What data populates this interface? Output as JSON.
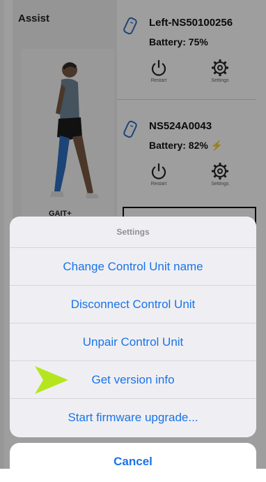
{
  "assist": {
    "title": "Assist",
    "gait_label": "GAIT+"
  },
  "devices": [
    {
      "name": "Left-NS50100256",
      "battery": "Battery: 75%",
      "charging": false,
      "restart_label": "Restart",
      "settings_label": "Settings"
    },
    {
      "name": "NS524A0043",
      "battery": "Battery: 82%",
      "charging": true,
      "restart_label": "Restart",
      "settings_label": "Settings"
    }
  ],
  "action_sheet": {
    "title": "Settings",
    "items": [
      "Change Control Unit name",
      "Disconnect Control Unit",
      "Unpair Control Unit",
      "Get version info",
      "Start firmware upgrade..."
    ],
    "cancel_label": "Cancel"
  },
  "colors": {
    "accent": "#1a73e8",
    "pointer": "#b5e61d",
    "leg_brace": "#2f6fbf"
  },
  "icons": {
    "device": "device-icon",
    "restart": "power-icon",
    "settings": "gear-icon",
    "charging": "lightning-icon",
    "pointer": "pointer-arrow-icon"
  }
}
